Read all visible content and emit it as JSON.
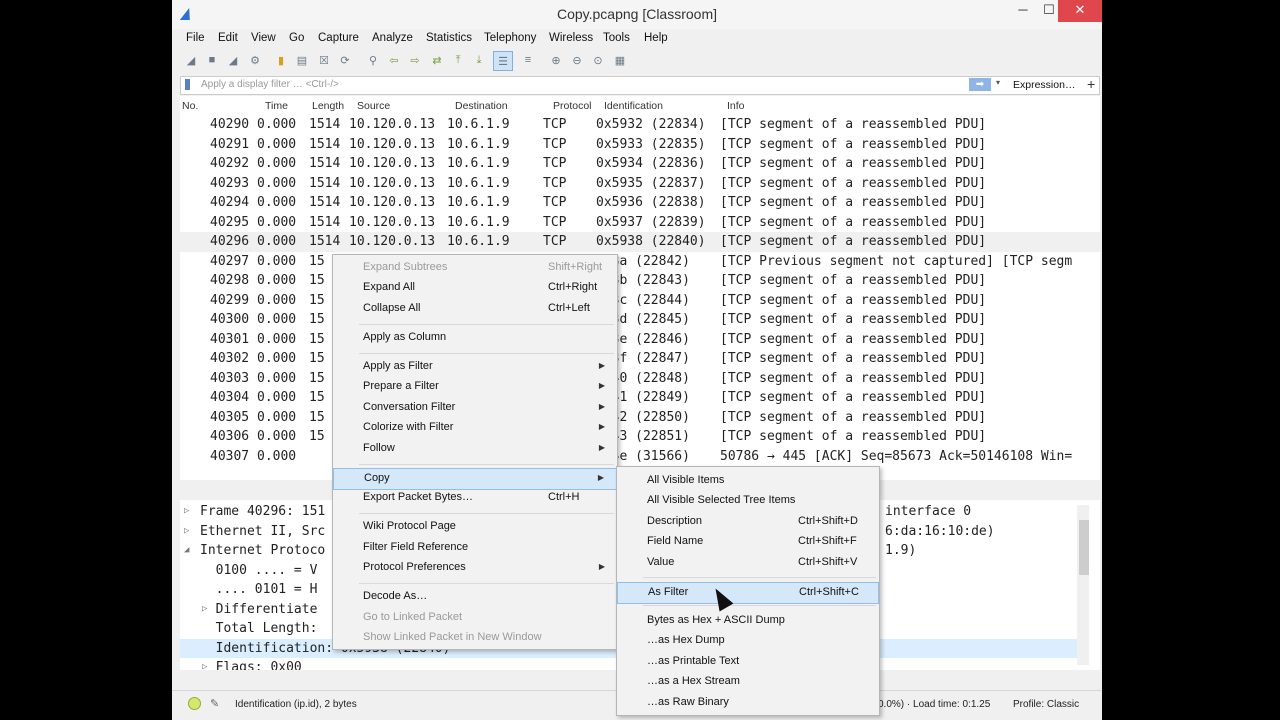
{
  "window": {
    "title": "Copy.pcapng [Classroom]",
    "minimize": "─",
    "maximize": "☐",
    "close": "✕"
  },
  "menubar": [
    "File",
    "Edit",
    "View",
    "Go",
    "Capture",
    "Analyze",
    "Statistics",
    "Telephony",
    "Wireless",
    "Tools",
    "Help"
  ],
  "filter": {
    "placeholder": "Apply a display filter … <Ctrl-/>",
    "arrow": "➡",
    "dropdown": "▾",
    "expression_label": "Expression…",
    "plus": "+"
  },
  "columns": [
    "No.",
    "Time",
    "Length",
    "Source",
    "Destination",
    "Protocol",
    "Identification",
    "Info"
  ],
  "packets": [
    {
      "no": "40290",
      "time": "0.000",
      "len": "1514",
      "src": "10.120.0.13",
      "dst": "10.6.1.9",
      "proto": "TCP",
      "id": "0x5932 (22834)",
      "info": "[TCP segment of a reassembled PDU]"
    },
    {
      "no": "40291",
      "time": "0.000",
      "len": "1514",
      "src": "10.120.0.13",
      "dst": "10.6.1.9",
      "proto": "TCP",
      "id": "0x5933 (22835)",
      "info": "[TCP segment of a reassembled PDU]"
    },
    {
      "no": "40292",
      "time": "0.000",
      "len": "1514",
      "src": "10.120.0.13",
      "dst": "10.6.1.9",
      "proto": "TCP",
      "id": "0x5934 (22836)",
      "info": "[TCP segment of a reassembled PDU]"
    },
    {
      "no": "40293",
      "time": "0.000",
      "len": "1514",
      "src": "10.120.0.13",
      "dst": "10.6.1.9",
      "proto": "TCP",
      "id": "0x5935 (22837)",
      "info": "[TCP segment of a reassembled PDU]"
    },
    {
      "no": "40294",
      "time": "0.000",
      "len": "1514",
      "src": "10.120.0.13",
      "dst": "10.6.1.9",
      "proto": "TCP",
      "id": "0x5936 (22838)",
      "info": "[TCP segment of a reassembled PDU]"
    },
    {
      "no": "40295",
      "time": "0.000",
      "len": "1514",
      "src": "10.120.0.13",
      "dst": "10.6.1.9",
      "proto": "TCP",
      "id": "0x5937 (22839)",
      "info": "[TCP segment of a reassembled PDU]"
    },
    {
      "no": "40296",
      "time": "0.000",
      "len": "1514",
      "src": "10.120.0.13",
      "dst": "10.6.1.9",
      "proto": "TCP",
      "id": "0x5938 (22840)",
      "info": "[TCP segment of a reassembled PDU]"
    },
    {
      "no": "40297",
      "time": "0.000",
      "len": "15",
      "src": "",
      "dst": "",
      "proto": "",
      "id": "593a (22842)",
      "info": "[TCP Previous segment not captured] [TCP segm"
    },
    {
      "no": "40298",
      "time": "0.000",
      "len": "15",
      "src": "",
      "dst": "",
      "proto": "",
      "id": "593b (22843)",
      "info": "[TCP segment of a reassembled PDU]"
    },
    {
      "no": "40299",
      "time": "0.000",
      "len": "15",
      "src": "",
      "dst": "",
      "proto": "",
      "id": "593c (22844)",
      "info": "[TCP segment of a reassembled PDU]"
    },
    {
      "no": "40300",
      "time": "0.000",
      "len": "15",
      "src": "",
      "dst": "",
      "proto": "",
      "id": "593d (22845)",
      "info": "[TCP segment of a reassembled PDU]"
    },
    {
      "no": "40301",
      "time": "0.000",
      "len": "15",
      "src": "",
      "dst": "",
      "proto": "",
      "id": "593e (22846)",
      "info": "[TCP segment of a reassembled PDU]"
    },
    {
      "no": "40302",
      "time": "0.000",
      "len": "15",
      "src": "",
      "dst": "",
      "proto": "",
      "id": "593f (22847)",
      "info": "[TCP segment of a reassembled PDU]"
    },
    {
      "no": "40303",
      "time": "0.000",
      "len": "15",
      "src": "",
      "dst": "",
      "proto": "",
      "id": "5940 (22848)",
      "info": "[TCP segment of a reassembled PDU]"
    },
    {
      "no": "40304",
      "time": "0.000",
      "len": "15",
      "src": "",
      "dst": "",
      "proto": "",
      "id": "5941 (22849)",
      "info": "[TCP segment of a reassembled PDU]"
    },
    {
      "no": "40305",
      "time": "0.000",
      "len": "15",
      "src": "",
      "dst": "",
      "proto": "",
      "id": "5942 (22850)",
      "info": "[TCP segment of a reassembled PDU]"
    },
    {
      "no": "40306",
      "time": "0.000",
      "len": "15",
      "src": "",
      "dst": "",
      "proto": "",
      "id": "5943 (22851)",
      "info": "[TCP segment of a reassembled PDU]"
    },
    {
      "no": "40307",
      "time": "0.000",
      "len": "",
      "src": "",
      "dst": "",
      "proto": "",
      "id": "7b4e (31566)",
      "info": "50786 → 445 [ACK] Seq=85673 Ack=50146108 Win="
    }
  ],
  "details": [
    {
      "caret": "▷",
      "text": "Frame 40296: 151",
      "tail": "interface 0"
    },
    {
      "caret": "▷",
      "text": "Ethernet II, Src",
      "tail": "6:da:16:10:de)"
    },
    {
      "caret": "◢",
      "text": "Internet Protoco",
      "tail": "1.9)"
    },
    {
      "caret": "",
      "text": "  0100 .... = V",
      "tail": ""
    },
    {
      "caret": "",
      "text": "  .... 0101 = H",
      "tail": ""
    },
    {
      "caret": "▷",
      "text": "  Differentiate",
      "tail": ""
    },
    {
      "caret": "",
      "text": "  Total Length:",
      "tail": ""
    },
    {
      "caret": "",
      "text": "  Identification: 0x5938 (22840)",
      "tail": ""
    },
    {
      "caret": "▷",
      "text": "  Flags: 0x00",
      "tail": ""
    }
  ],
  "context_menu": [
    {
      "label": "Expand Subtrees",
      "shortcut": "Shift+Right",
      "disabled": true
    },
    {
      "label": "Expand All",
      "shortcut": "Ctrl+Right"
    },
    {
      "label": "Collapse All",
      "shortcut": "Ctrl+Left"
    },
    {
      "sep": true
    },
    {
      "label": "Apply as Column",
      "shortcut": ""
    },
    {
      "sep": true
    },
    {
      "label": "Apply as Filter",
      "submenu": true
    },
    {
      "label": "Prepare a Filter",
      "submenu": true
    },
    {
      "label": "Conversation Filter",
      "submenu": true
    },
    {
      "label": "Colorize with Filter",
      "submenu": true
    },
    {
      "label": "Follow",
      "submenu": true
    },
    {
      "sep": true
    },
    {
      "label": "Copy",
      "submenu": true,
      "highlight": true
    },
    {
      "label": "Export Packet Bytes…",
      "shortcut": "Ctrl+H"
    },
    {
      "sep": true
    },
    {
      "label": "Wiki Protocol Page"
    },
    {
      "label": "Filter Field Reference"
    },
    {
      "label": "Protocol Preferences",
      "submenu": true
    },
    {
      "sep": true
    },
    {
      "label": "Decode As…"
    },
    {
      "label": "Go to Linked Packet",
      "disabled": true
    },
    {
      "label": "Show Linked Packet in New Window",
      "disabled": true
    }
  ],
  "copy_submenu": [
    {
      "label": "All Visible Items"
    },
    {
      "label": "All Visible Selected Tree Items"
    },
    {
      "label": "Description",
      "shortcut": "Ctrl+Shift+D"
    },
    {
      "label": "Field Name",
      "shortcut": "Ctrl+Shift+F"
    },
    {
      "label": "Value",
      "shortcut": "Ctrl+Shift+V"
    },
    {
      "sep": true
    },
    {
      "label": "As Filter",
      "shortcut": "Ctrl+Shift+C",
      "highlight": true
    },
    {
      "sep": true
    },
    {
      "label": "Bytes as Hex + ASCII Dump"
    },
    {
      "label": "…as Hex Dump"
    },
    {
      "label": "…as Printable Text"
    },
    {
      "label": "…as a Hex Stream"
    },
    {
      "label": "…as Raw Binary"
    }
  ],
  "status": {
    "field": "Identification (ip.id), 2 bytes",
    "load": "0.0%) · Load time: 0:1.25",
    "profile": "Profile: Classic"
  }
}
